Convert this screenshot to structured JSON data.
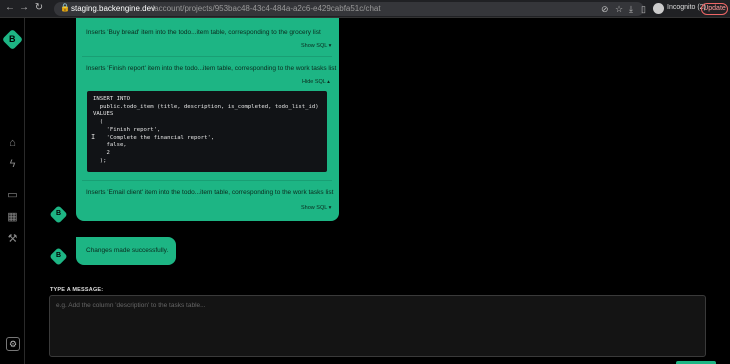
{
  "browser": {
    "url_host": "staging.backengine.dev",
    "url_path": "/account/projects/953bac48-43c4-484a-a2c6-e429cabfa51c/chat",
    "incognito_label": "Incognito (2)",
    "update_label": "Update"
  },
  "chat": {
    "messages": [
      {
        "text": "Inserts 'Buy bread' item into the todo...item table, corresponding to the grocery list",
        "toggle": "Show SQL ▾"
      },
      {
        "text": "Inserts 'Finish report' item into the todo...item table, corresponding to the work tasks list",
        "toggle": "Hide SQL ▴",
        "code": "INSERT INTO\n  public.todo_item (title, description, is_completed, todo_list_id)\nVALUES\n  (\n    'Finish report',\n    'Complete the financial report',\n    false,\n    2\n  );"
      },
      {
        "text": "Inserts 'Email client' item into the todo...item table, corresponding to the work tasks list",
        "toggle": "Show SQL ▾"
      }
    ],
    "success_message": "Changes made successfully."
  },
  "input": {
    "label": "TYPE A MESSAGE:",
    "placeholder": "e.g. Add the column 'description' to the tasks table..."
  },
  "colors": {
    "accent": "#1db584",
    "background": "#000000"
  }
}
